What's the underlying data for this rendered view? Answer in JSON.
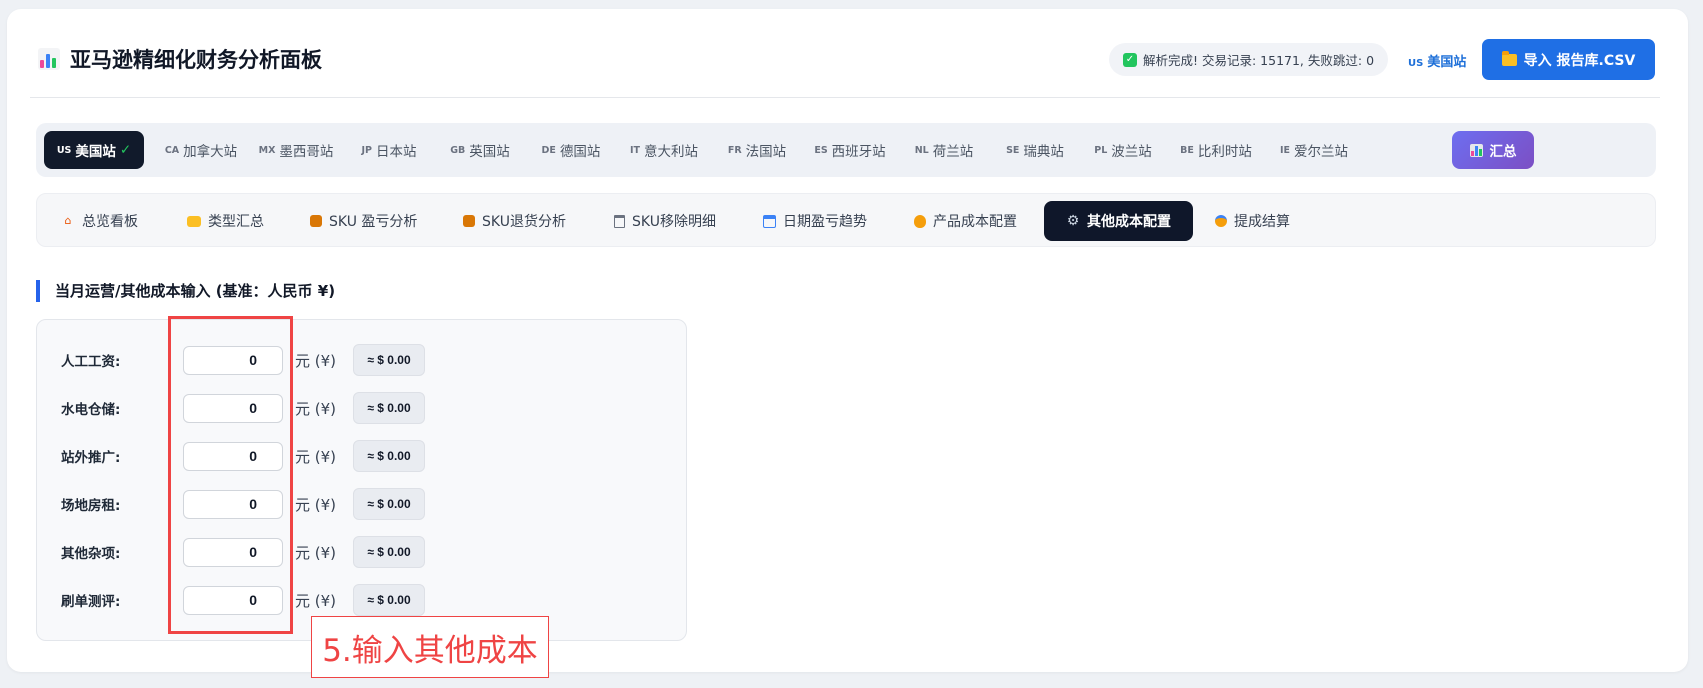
{
  "header": {
    "title": "亚马逊精细化财务分析面板",
    "status_text": "解析完成! 交易记录: 15171, 失败跳过: 0",
    "site_code": "US",
    "site_label": "美国站",
    "import_label": "导入 报告库.CSV"
  },
  "countries": [
    {
      "code": "US",
      "label": "美国站",
      "active": true,
      "suffix": "✓"
    },
    {
      "code": "CA",
      "label": "加拿大站"
    },
    {
      "code": "MX",
      "label": "墨西哥站"
    },
    {
      "code": "JP",
      "label": "日本站"
    },
    {
      "code": "GB",
      "label": "英国站"
    },
    {
      "code": "DE",
      "label": "德国站"
    },
    {
      "code": "IT",
      "label": "意大利站"
    },
    {
      "code": "FR",
      "label": "法国站"
    },
    {
      "code": "ES",
      "label": "西班牙站"
    },
    {
      "code": "NL",
      "label": "荷兰站"
    },
    {
      "code": "SE",
      "label": "瑞典站"
    },
    {
      "code": "PL",
      "label": "波兰站"
    },
    {
      "code": "BE",
      "label": "比利时站"
    },
    {
      "code": "IE",
      "label": "爱尔兰站"
    }
  ],
  "summary_label": "汇总",
  "nav_tabs": [
    {
      "label": "总览看板",
      "icon": "house-icon"
    },
    {
      "label": "类型汇总",
      "icon": "folder-icon"
    },
    {
      "label": "SKU 盈亏分析",
      "icon": "box-icon"
    },
    {
      "label": "SKU退货分析",
      "icon": "box-icon"
    },
    {
      "label": "SKU移除明细",
      "icon": "trash-icon"
    },
    {
      "label": "日期盈亏趋势",
      "icon": "calendar-icon"
    },
    {
      "label": "产品成本配置",
      "icon": "money-bag-icon"
    },
    {
      "label": "其他成本配置",
      "icon": "gear-icon",
      "active": true
    },
    {
      "label": "提成结算",
      "icon": "medal-icon"
    }
  ],
  "section_title": "当月运营/其他成本输入 (基准：人民币 ¥)",
  "cost_rows": [
    {
      "label": "人工工资:",
      "value": "0",
      "unit": "元 (¥)",
      "usd": "≈ $ 0.00"
    },
    {
      "label": "水电仓储:",
      "value": "0",
      "unit": "元 (¥)",
      "usd": "≈ $ 0.00"
    },
    {
      "label": "站外推广:",
      "value": "0",
      "unit": "元 (¥)",
      "usd": "≈ $ 0.00"
    },
    {
      "label": "场地房租:",
      "value": "0",
      "unit": "元 (¥)",
      "usd": "≈ $ 0.00"
    },
    {
      "label": "其他杂项:",
      "value": "0",
      "unit": "元 (¥)",
      "usd": "≈ $ 0.00"
    },
    {
      "label": "刷单测评:",
      "value": "0",
      "unit": "元 (¥)",
      "usd": "≈ $ 0.00"
    }
  ],
  "annotation": "5.输入其他成本",
  "colors": {
    "accent": "#1f6fe5",
    "dark": "#0f172a",
    "annotation": "#ef4444",
    "success": "#22c55e"
  }
}
